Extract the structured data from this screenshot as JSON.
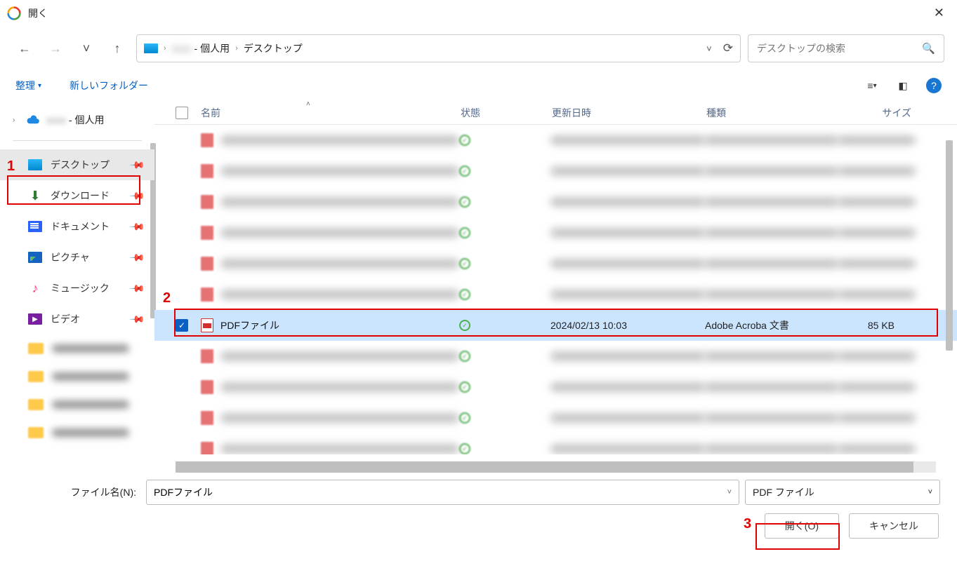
{
  "window": {
    "title": "開く"
  },
  "nav": {
    "back": "←",
    "forward": "→",
    "recent": "˅",
    "up": "↑"
  },
  "breadcrumb": {
    "seg_user_suffix": " - 個人用",
    "seg_desktop": "デスクトップ"
  },
  "search": {
    "placeholder": "デスクトップの検索"
  },
  "toolbar": {
    "organize": "整理",
    "newfolder": "新しいフォルダー"
  },
  "sidebar": {
    "tree_root_suffix": " - 個人用",
    "items": [
      {
        "label": "デスクトップ",
        "icon": "desktop"
      },
      {
        "label": "ダウンロード",
        "icon": "download"
      },
      {
        "label": "ドキュメント",
        "icon": "docs"
      },
      {
        "label": "ピクチャ",
        "icon": "pics"
      },
      {
        "label": "ミュージック",
        "icon": "music"
      },
      {
        "label": "ビデオ",
        "icon": "video"
      }
    ]
  },
  "columns": {
    "name": "名前",
    "state": "状態",
    "date": "更新日時",
    "type": "種類",
    "size": "サイズ"
  },
  "file": {
    "name": "PDFファイル",
    "date": "2024/02/13 10:03",
    "type": "Adobe Acroba 文書",
    "size": "85 KB"
  },
  "footer": {
    "filename_label": "ファイル名(N):",
    "filename_value": "PDFファイル",
    "filter_label": "PDF ファイル",
    "open_button": "開く(O)",
    "cancel_button": "キャンセル"
  },
  "anno": {
    "n1": "1",
    "n2": "2",
    "n3": "3"
  }
}
